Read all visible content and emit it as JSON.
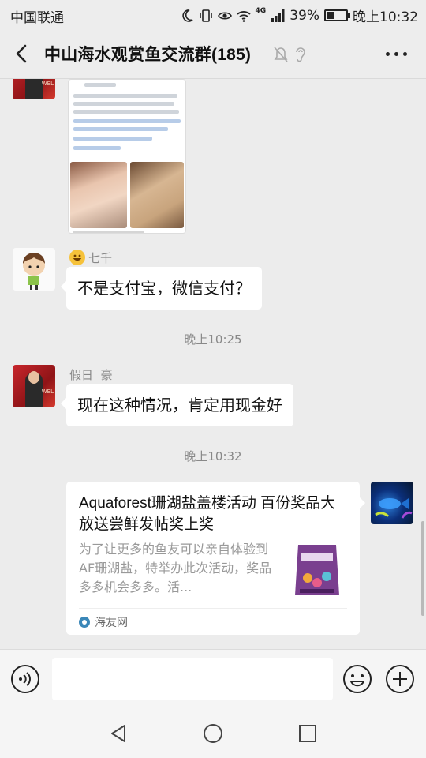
{
  "status_bar": {
    "carrier": "中国联通",
    "network": "4G",
    "battery": "39%",
    "battery_level": 0.39,
    "time": "晚上10:32"
  },
  "header": {
    "title": "中山海水观赏鱼交流群(185)"
  },
  "messages": [
    {
      "sender": "七千",
      "text": "不是支付宝，微信支付？"
    },
    {
      "time": "晚上10:25"
    },
    {
      "sender": "假日  豪",
      "text": "现在这种情况，肯定用现金好"
    },
    {
      "time": "晚上10:32"
    },
    {
      "card_title": "Aquaforest珊湖盐盖楼活动 百份奖品大放送尝鲜发帖奖上奖",
      "card_desc": "为了让更多的鱼友可以亲自体验到AF珊湖盐，特举办此次活动，奖品多多机会多多。活...",
      "card_source": "海友网"
    }
  ],
  "icons": {
    "back": "back-arrow-icon",
    "mute": "mute-bell-icon",
    "earpiece": "earpiece-icon",
    "more": "more-dots-icon",
    "voice": "voice-input-icon",
    "emoji": "emoji-icon",
    "plus": "plus-icon"
  },
  "colors": {
    "background": "#ececec",
    "bubble": "#ffffff",
    "meta_text": "#888888"
  }
}
